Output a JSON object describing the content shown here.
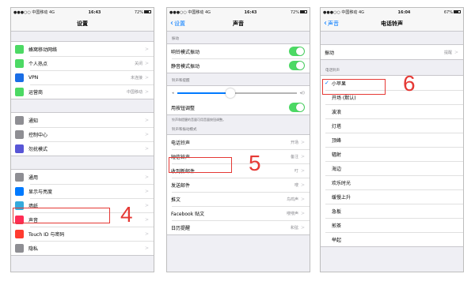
{
  "phone1": {
    "status": {
      "left": "●●●○○ 中国移动 4G",
      "time": "16:43",
      "right": "72%"
    },
    "title": "设置",
    "group1": [
      {
        "label": "蜂窝移动网络",
        "icon": "cellular-icon",
        "color": "#4cd964",
        "detail": ""
      },
      {
        "label": "个人热点",
        "icon": "hotspot-icon",
        "color": "#4cd964",
        "detail": "关闭"
      },
      {
        "label": "VPN",
        "icon": "vpn-icon",
        "color": "#1a6ee6",
        "detail": "未连接"
      },
      {
        "label": "运营商",
        "icon": "carrier-icon",
        "color": "#4cd964",
        "detail": "中国移动"
      }
    ],
    "group2": [
      {
        "label": "通知",
        "icon": "notifications-icon",
        "color": "#8e8e93"
      },
      {
        "label": "控制中心",
        "icon": "control-center-icon",
        "color": "#8e8e93"
      },
      {
        "label": "勿扰模式",
        "icon": "do-not-disturb-icon",
        "color": "#5856d6"
      }
    ],
    "group3": [
      {
        "label": "通用",
        "icon": "general-icon",
        "color": "#8e8e93"
      },
      {
        "label": "显示与亮度",
        "icon": "display-icon",
        "color": "#007aff"
      },
      {
        "label": "墙纸",
        "icon": "wallpaper-icon",
        "color": "#34aadc"
      },
      {
        "label": "声音",
        "icon": "sounds-icon",
        "color": "#ff2d55"
      },
      {
        "label": "Touch ID 与密码",
        "icon": "touchid-icon",
        "color": "#ff3b30"
      },
      {
        "label": "隐私",
        "icon": "privacy-icon",
        "color": "#8e8e93"
      }
    ],
    "marker": "4"
  },
  "phone2": {
    "status": {
      "left": "●●●○○ 中国移动 4G",
      "time": "16:43",
      "right": "72%"
    },
    "back": "设置",
    "title": "声音",
    "sec_vibrate": "振动",
    "vibrate": [
      {
        "label": "响铃模式振动"
      },
      {
        "label": "静音模式振动"
      }
    ],
    "sec_ringer": "铃声和提醒",
    "slider_value": 0.45,
    "change_with_buttons": "用按钮调整",
    "footnote": "铃声和提醒的音量可用音量按钮调整。",
    "sec_patterns": "铃声和振动模式",
    "patterns": [
      {
        "label": "电话铃声",
        "detail": "开场"
      },
      {
        "label": "短信铃声",
        "detail": "备注"
      },
      {
        "label": "收到新邮件",
        "detail": "叮"
      },
      {
        "label": "发送邮件",
        "detail": "嗖"
      },
      {
        "label": "推文",
        "detail": "鸟鸣声"
      },
      {
        "label": "Facebook 贴文",
        "detail": "嗖嗖声"
      },
      {
        "label": "日历提醒",
        "detail": "和弦"
      }
    ],
    "marker": "5"
  },
  "phone3": {
    "status": {
      "left": "●●●○○ 中国移动 4G",
      "time": "16:04",
      "right": "67%"
    },
    "back": "声音",
    "title": "电话铃声",
    "vibration_label": "振动",
    "vibration_value": "提醒",
    "sec_ringtones": "电话铃声",
    "ringtones": [
      "小苹果",
      "开场 (默认)",
      "波浪",
      "灯塔",
      "顶峰",
      "辐射",
      "海边",
      "欢乐时光",
      "缓慢上升",
      "急板",
      "煎茶",
      "举起"
    ],
    "selected_index": 0,
    "marker": "6"
  }
}
